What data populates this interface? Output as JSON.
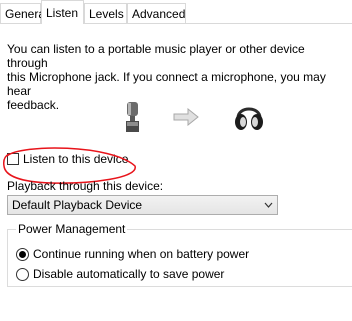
{
  "tabs": [
    {
      "label": "General",
      "active": false
    },
    {
      "label": "Listen",
      "active": true
    },
    {
      "label": "Levels",
      "active": false
    },
    {
      "label": "Advanced",
      "active": false
    }
  ],
  "description": "You can listen to a portable music player or other device through\nthis Microphone jack.  If you connect a microphone, you may hear\nfeedback.",
  "illustration": {
    "source_icon": "microphone-icon",
    "arrow_icon": "right-arrow-icon",
    "target_icon": "headphones-icon"
  },
  "listen_checkbox": {
    "label": "Listen to this device",
    "checked": false
  },
  "playback": {
    "label": "Playback through this device:",
    "selected": "Default Playback Device"
  },
  "power_management": {
    "title": "Power Management",
    "options": [
      {
        "label": "Continue running when on battery power",
        "checked": true
      },
      {
        "label": "Disable automatically to save power",
        "checked": false
      }
    ]
  },
  "colors": {
    "annotation": "#e8141b",
    "border": "#d9d9d9"
  }
}
